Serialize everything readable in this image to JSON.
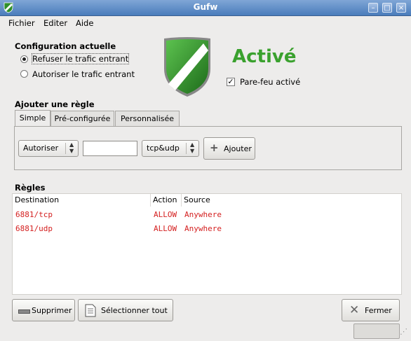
{
  "window": {
    "title": "Gufw"
  },
  "menubar": {
    "items": [
      {
        "label": "Fichier"
      },
      {
        "label": "Editer"
      },
      {
        "label": "Aide"
      }
    ]
  },
  "config": {
    "heading": "Configuration actuelle",
    "option_deny": "Refuser le trafic entrant",
    "option_allow": "Autoriser le trafic entrant",
    "selected": "deny"
  },
  "status": {
    "text": "Activé",
    "color": "#3aa12e",
    "checkbox_label": "Pare-feu activé",
    "checked": true
  },
  "add_rule": {
    "heading": "Ajouter une règle",
    "tabs": [
      {
        "label": "Simple"
      },
      {
        "label": "Pré-configurée"
      },
      {
        "label": "Personnalisée"
      }
    ],
    "active_tab": "Simple",
    "action_value": "Autoriser",
    "port_value": "",
    "protocol_value": "tcp&udp",
    "add_button": "Ajouter"
  },
  "rules": {
    "heading": "Règles",
    "columns": [
      "Destination",
      "Action",
      "Source"
    ],
    "rows": [
      {
        "destination": "6881/tcp",
        "action": "ALLOW",
        "source": "Anywhere"
      },
      {
        "destination": "6881/udp",
        "action": "ALLOW",
        "source": "Anywhere"
      }
    ],
    "row_color": "#d42020"
  },
  "buttons": {
    "delete": "Supprimer",
    "select_all": "Sélectionner tout",
    "close": "Fermer"
  },
  "colors": {
    "titlebar": "#4a7cbb",
    "shield_green": "#2f8f2a"
  }
}
